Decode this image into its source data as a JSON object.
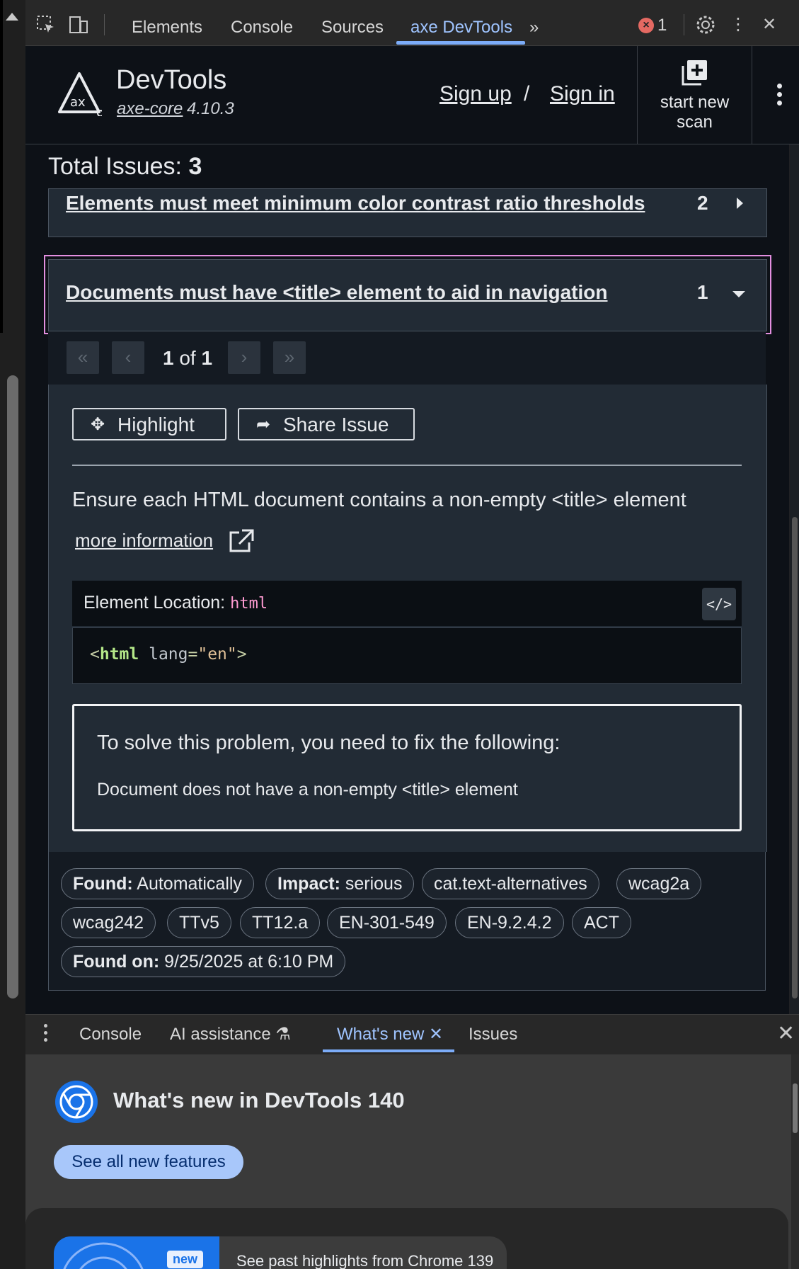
{
  "devtools_tabs": {
    "items": [
      "Elements",
      "Console",
      "Sources",
      "axe DevTools"
    ],
    "active": "axe DevTools",
    "more": "»",
    "error_count": "1"
  },
  "axe_header": {
    "app_name": "DevTools",
    "axe_core_link": "axe-core",
    "axe_version": "4.10.3",
    "sign_up": "Sign up",
    "separator": "/",
    "sign_in": "Sign in",
    "start_scan_line1": "start new",
    "start_scan_line2": "scan"
  },
  "results": {
    "total_label": "Total Issues:",
    "total_value": "3",
    "issues": [
      {
        "title": "Elements must meet minimum color contrast ratio thresholds",
        "count": "2",
        "expanded": false
      },
      {
        "title": "Documents must have <title> element to aid in navigation",
        "count": "1",
        "expanded": true
      }
    ]
  },
  "pager": {
    "current": "1",
    "of": "of",
    "total": "1",
    "first": "«",
    "prev": "‹",
    "next": "›",
    "last": "»"
  },
  "details": {
    "highlight_label": "Highlight",
    "share_label": "Share Issue",
    "description": "Ensure each HTML document contains a non-empty <title> element",
    "more_info": "more information",
    "location_label": "Element Location:",
    "location_value": "html",
    "code_button": "</>",
    "code": {
      "open": "<",
      "tag": "html",
      "attr": "lang",
      "eq": "=",
      "value": "\"en\"",
      "close": ">"
    },
    "fix_heading": "To solve this problem, you need to fix the following:",
    "fix_item": "Document does not have a non-empty <title> element"
  },
  "tags": {
    "found_key": "Found:",
    "found_val": "Automatically",
    "impact_key": "Impact:",
    "impact_val": "serious",
    "list": [
      "cat.text-alternatives",
      "wcag2a",
      "wcag242",
      "TTv5",
      "TT12.a",
      "EN-301-549",
      "EN-9.2.4.2",
      "ACT"
    ],
    "found_on_key": "Found on:",
    "found_on_val": "9/25/2025 at 6:10 PM"
  },
  "drawer": {
    "tabs": [
      "Console",
      "AI assistance",
      "What's new",
      "Issues"
    ],
    "active": "What's new",
    "title": "What's new in DevTools 140",
    "see_all": "See all new features",
    "badge": "new",
    "past_highlights": "See past highlights from Chrome 139"
  },
  "colors": {
    "accent_blue": "#7cacf8",
    "focus_outline": "#e38fe0",
    "error_red": "#e46962",
    "panel_bg": "#0d1117",
    "card_bg": "#222b35"
  },
  "icons": [
    "select-element-icon",
    "device-toolbar-icon",
    "error-icon",
    "settings-gear-icon",
    "more-vert-icon",
    "close-icon",
    "axe-logo-icon",
    "start-scan-icon",
    "highlight-crosshair-icon",
    "share-arrow-icon",
    "external-link-icon",
    "code-icon",
    "experiment-flask-icon",
    "chrome-icon"
  ]
}
